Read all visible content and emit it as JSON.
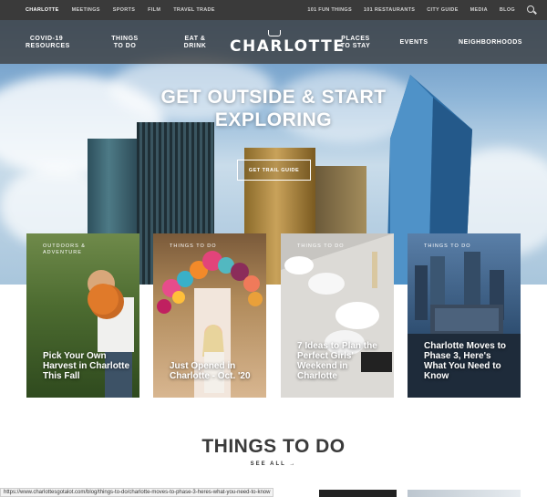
{
  "topbar": {
    "left_links": [
      "Charlotte",
      "Meetings",
      "Sports",
      "Film",
      "Travel Trade"
    ],
    "right_links": [
      "101 Fun Things",
      "101 Restaurants",
      "City Guide",
      "Media",
      "Blog"
    ]
  },
  "nav": {
    "items": [
      "COVID-19\nResources",
      "Things\nTo Do",
      "Eat &\nDrink",
      "Places\nTo Stay",
      "Events",
      "Neighborhoods"
    ],
    "logo": "CHARLOTTE"
  },
  "hero": {
    "title": "GET OUTSIDE & START EXPLORING",
    "button": "GET TRAIL GUIDE"
  },
  "cards": [
    {
      "tag": "Outdoors & Adventure",
      "title": "Pick Your Own Harvest in Charlotte This Fall"
    },
    {
      "tag": "Things To Do",
      "title": "Just Opened in Charlotte - Oct. '20"
    },
    {
      "tag": "Things To Do",
      "title": "7 Ideas to Plan the Perfect Girls' Weekend in Charlotte"
    },
    {
      "tag": "Things To Do",
      "title": "Charlotte Moves to Phase 3, Here's What You Need to Know"
    }
  ],
  "section": {
    "title": "THINGS TO DO",
    "see_all": "SEE ALL →"
  },
  "status_url": "https://www.charlottesgotalot.com/blog/things-to-do/charlotte-moves-to-phase-3-heres-what-you-need-to-know",
  "colors": {
    "topbar_bg": "#3a3a3a",
    "nav_bg": "#3c3c3c",
    "section_title": "#3a3a3a"
  }
}
